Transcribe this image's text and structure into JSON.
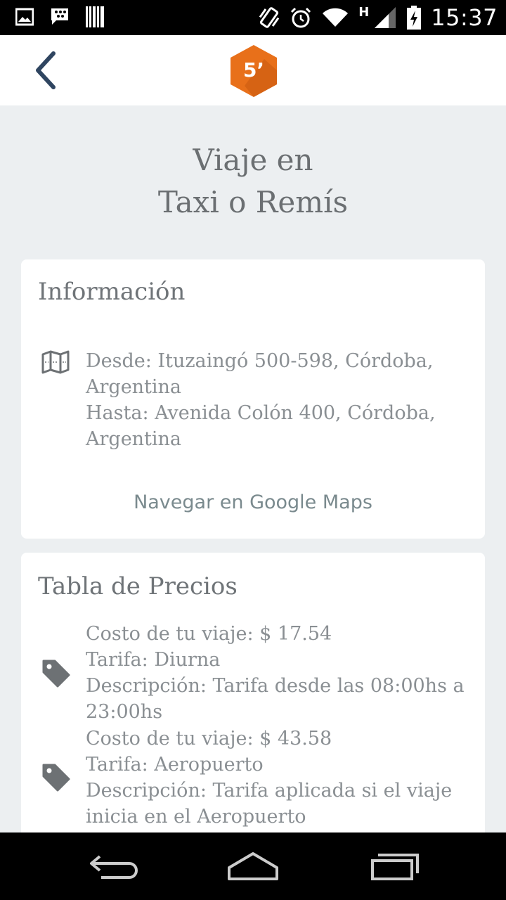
{
  "status_bar": {
    "time": "15:37",
    "network": "H",
    "icons": [
      "image-icon",
      "bbm-icon",
      "barcode-icon",
      "vibrate-icon",
      "alarm-icon",
      "wifi-icon",
      "signal-icon",
      "battery-charging-icon"
    ]
  },
  "app_bar": {
    "back_icon": "back-chevron-icon",
    "logo_text": "5’",
    "logo_color": "#e8701a"
  },
  "page": {
    "title_line1": "Viaje en",
    "title_line2": "Taxi o Remís"
  },
  "info_card": {
    "title": "Información",
    "icon": "map-icon",
    "lines": [
      "Desde: Ituzaingó 500-598, Córdoba,",
      "Argentina",
      "Hasta: Avenida Colón 400, Córdoba,",
      "Argentina"
    ],
    "link": "Navegar en Google Maps"
  },
  "prices_card": {
    "title": "Tabla de Precios",
    "items": [
      {
        "icon": "tag-icon",
        "lines": [
          "Costo de tu viaje: $ 17.54",
          "Tarifa: Diurna",
          "Descripción: Tarifa desde las 08:00hs a",
          "23:00hs"
        ]
      },
      {
        "icon": "tag-icon",
        "lines": [
          "Costo de tu viaje: $ 43.58",
          "Tarifa: Aeropuerto",
          "Descripción: Tarifa aplicada si el viaje",
          "inicia en el Aeropuerto"
        ]
      }
    ]
  },
  "nav_bar": {
    "icons": [
      "back-icon",
      "home-icon",
      "recents-icon"
    ]
  },
  "colors": {
    "background": "#eceff1",
    "card": "#ffffff",
    "text": "#8a8f93",
    "brand": "#e8701a"
  }
}
